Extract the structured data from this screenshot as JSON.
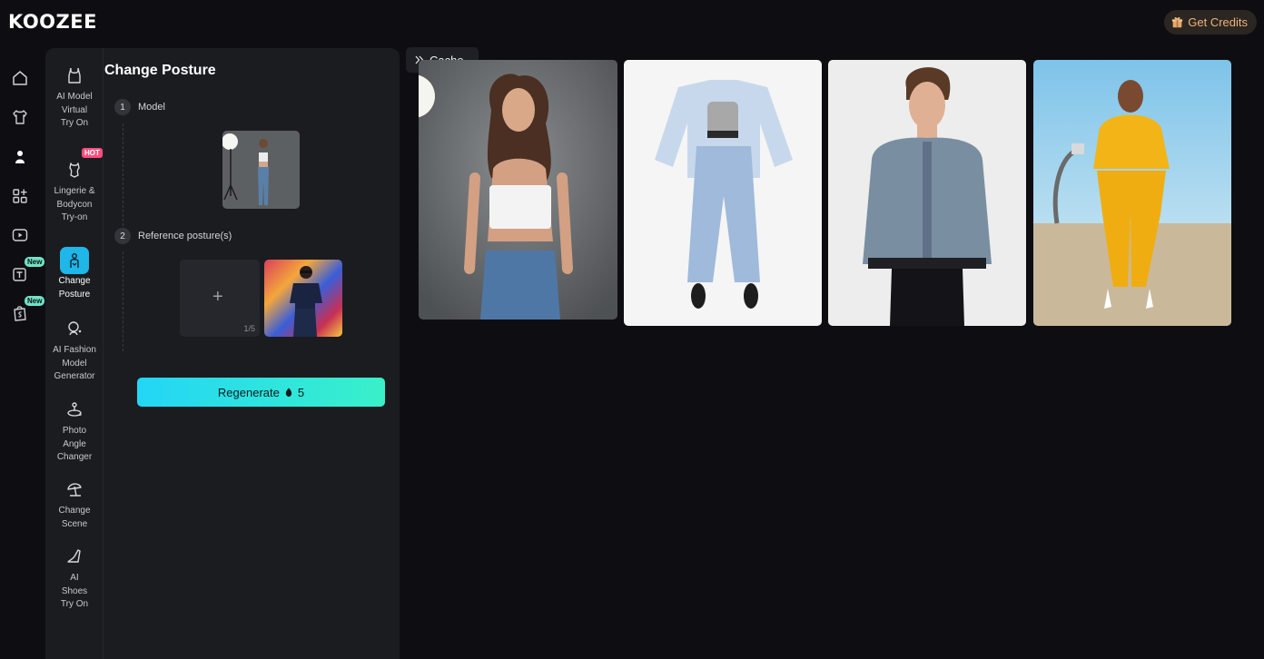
{
  "app": {
    "logo_text": "KOOZEE",
    "get_credits_label": "Get Credits"
  },
  "rail": {
    "items": [
      {
        "icon": "home-icon"
      },
      {
        "icon": "shirt-icon"
      },
      {
        "icon": "person-icon"
      },
      {
        "icon": "apps-grid-icon"
      },
      {
        "icon": "video-play-icon"
      },
      {
        "icon": "text-tool-icon",
        "badge": "New"
      },
      {
        "icon": "shopify-bag-icon",
        "badge": "New"
      }
    ]
  },
  "tools": [
    {
      "label": "AI Model Virtual Try On",
      "icon": "tank-top-icon",
      "active": false
    },
    {
      "label": "Lingerie & Bodycon Try-on",
      "icon": "bodysuit-icon",
      "badge": "HOT",
      "active": false
    },
    {
      "label": "Change Posture",
      "icon": "posture-icon",
      "active": true
    },
    {
      "label": "AI Fashion Model Generator",
      "icon": "model-generator-icon",
      "active": false
    },
    {
      "label": "Photo Angle Changer",
      "icon": "angle-rotate-icon",
      "active": false
    },
    {
      "label": "Change Scene",
      "icon": "beach-umbrella-icon",
      "active": false
    },
    {
      "label": "AI Shoes Try On",
      "icon": "high-heel-icon",
      "active": false
    }
  ],
  "panel": {
    "title": "Change Posture",
    "step1": {
      "number": "1",
      "label": "Model"
    },
    "step2": {
      "number": "2",
      "label": "Reference posture(s)"
    },
    "upload": {
      "plus": "+",
      "count": "1/5"
    },
    "regenerate_label": "Regenerate",
    "regenerate_cost": "5"
  },
  "gallery": {
    "cache_label": "Cache",
    "images": [
      {
        "name": "woman-white-crop-top",
        "desc_color": "#7b7e80"
      },
      {
        "name": "outfit-flatlay",
        "desc_color": "#f4f4f4"
      },
      {
        "name": "man-denim-bomber",
        "desc_color": "#ececec"
      },
      {
        "name": "woman-yellow-tracksuit",
        "desc_color": "#8cc6e6"
      }
    ]
  },
  "colors": {
    "accent": "#1fb6e8",
    "regen_gradient_start": "#23d6f6",
    "regen_gradient_end": "#39f0c9",
    "credits_text": "#f0b27a",
    "hot_badge": "#ff4d7d",
    "new_badge": "#6ee3c8"
  }
}
